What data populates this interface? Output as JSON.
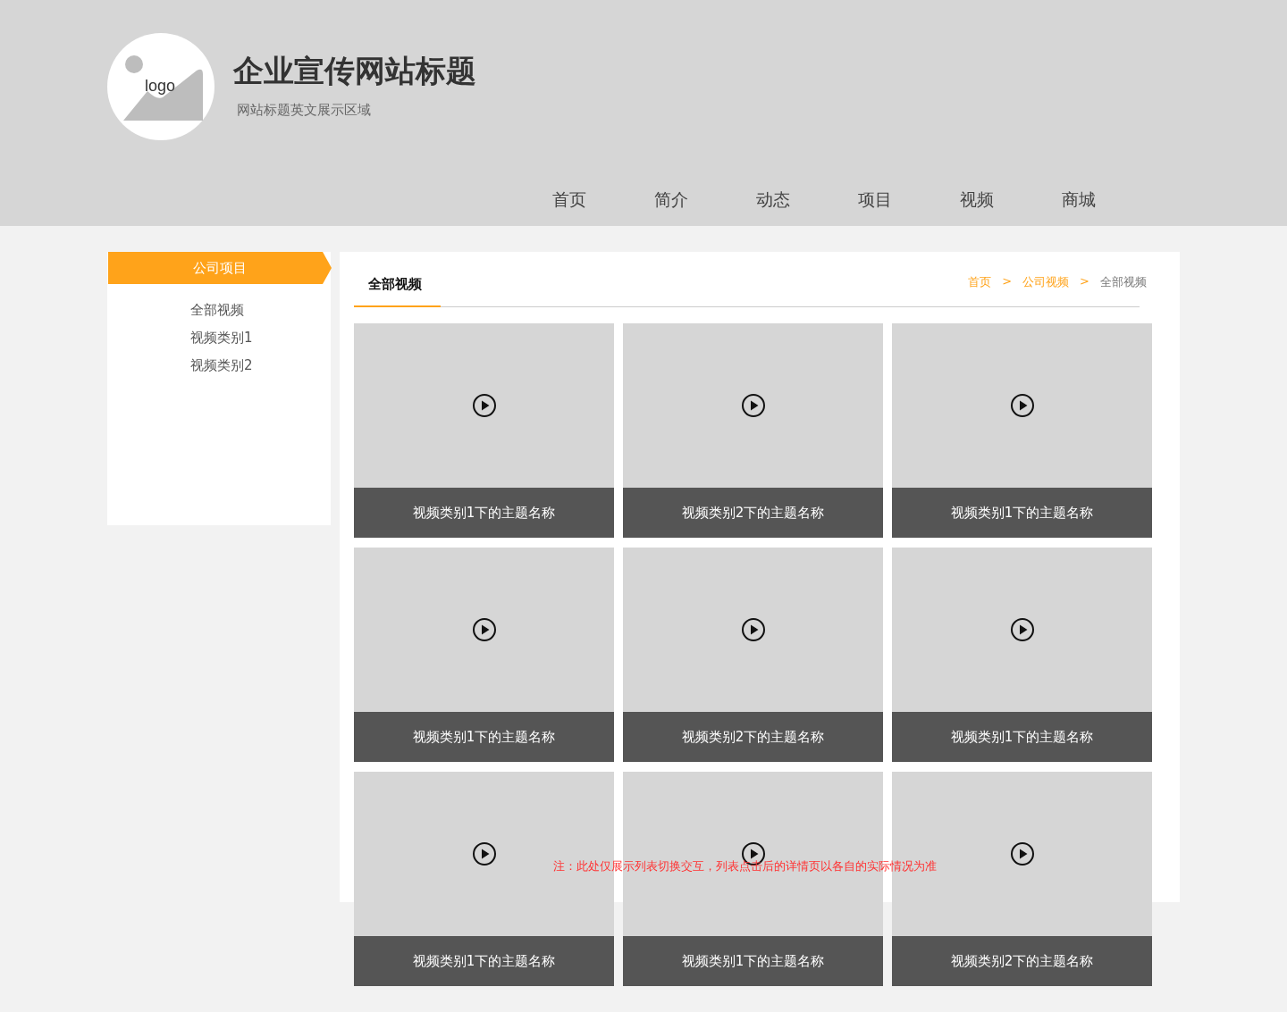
{
  "header": {
    "logo_text": "logo",
    "title": "企业宣传网站标题",
    "subtitle": "网站标题英文展示区域"
  },
  "nav": [
    {
      "label": "首页"
    },
    {
      "label": "简介"
    },
    {
      "label": "动态"
    },
    {
      "label": "项目"
    },
    {
      "label": "视频"
    },
    {
      "label": "商城"
    }
  ],
  "sidebar": {
    "heading": "公司项目",
    "items": [
      {
        "label": "全部视频"
      },
      {
        "label": "视频类别1"
      },
      {
        "label": "视频类别2"
      }
    ]
  },
  "content": {
    "tab": "全部视频",
    "breadcrumb": [
      {
        "label": "首页",
        "kind": "link"
      },
      {
        "label": ">",
        "kind": "separator"
      },
      {
        "label": "公司视频",
        "kind": "link"
      },
      {
        "label": ">",
        "kind": "separator"
      },
      {
        "label": "全部视频",
        "kind": "current"
      }
    ],
    "videos": [
      {
        "title": "视频类别1下的主题名称"
      },
      {
        "title": "视频类别2下的主题名称"
      },
      {
        "title": "视频类别1下的主题名称"
      },
      {
        "title": "视频类别1下的主题名称"
      },
      {
        "title": "视频类别2下的主题名称"
      },
      {
        "title": "视频类别1下的主题名称"
      },
      {
        "title": "视频类别1下的主题名称"
      },
      {
        "title": "视频类别1下的主题名称"
      },
      {
        "title": "视频类别2下的主题名称"
      }
    ],
    "note": "注：此处仅展示列表切换交互，列表点击后的详情页以各自的实际情况为准"
  }
}
